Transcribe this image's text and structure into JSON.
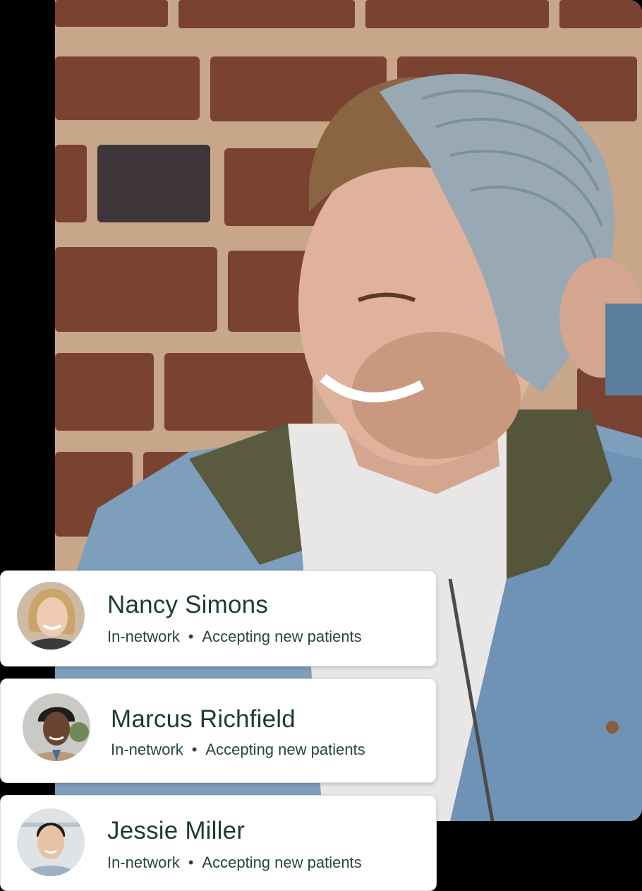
{
  "hero_photo": {
    "icon": "smiling-man-in-beanie-photo"
  },
  "providers": [
    {
      "name": "Nancy Simons",
      "network": "In-network",
      "separator": "•",
      "availability": "Accepting new patients",
      "avatar_icon": "woman-blonde-avatar"
    },
    {
      "name": "Marcus Richfield",
      "network": "In-network",
      "separator": "•",
      "availability": "Accepting new patients",
      "avatar_icon": "man-dreadlocks-avatar"
    },
    {
      "name": "Jessie Miller",
      "network": "In-network",
      "separator": "•",
      "availability": "Accepting new patients",
      "avatar_icon": "man-glasses-avatar"
    }
  ],
  "colors": {
    "name_text": "#1d3b36",
    "meta_text": "#264640",
    "card_bg": "#ffffff",
    "page_bg": "#000000"
  }
}
